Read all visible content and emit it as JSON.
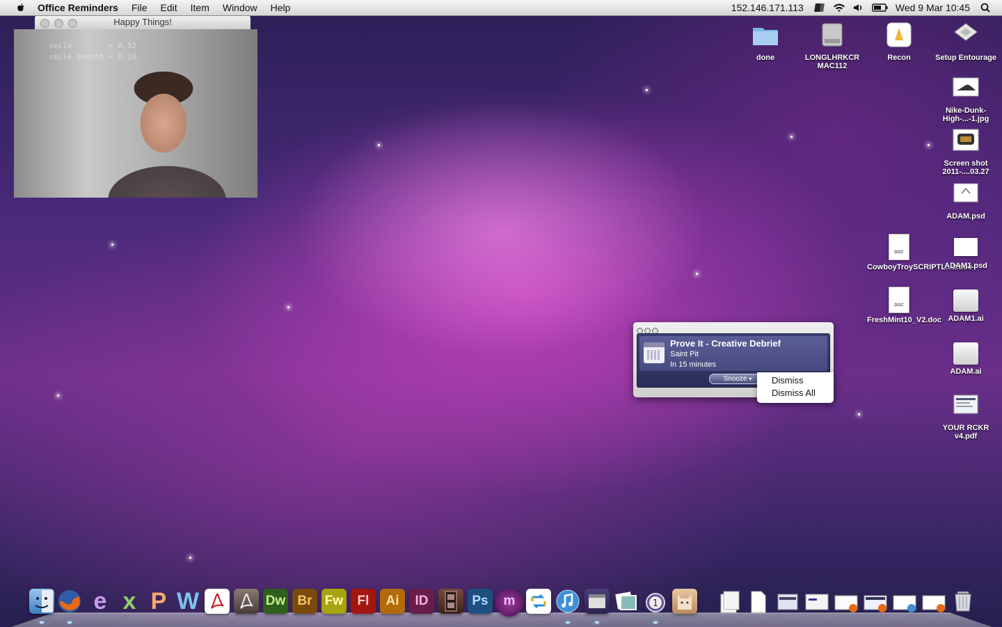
{
  "menubar": {
    "app_name": "Office Reminders",
    "items": [
      "File",
      "Edit",
      "Item",
      "Window",
      "Help"
    ],
    "ip_address": "152.146.171.113",
    "clock": "Wed 9 Mar  10:45",
    "status_icons": [
      "script-icon",
      "wifi-icon",
      "volume-icon",
      "battery-icon",
      "spotlight-icon"
    ]
  },
  "cam_window": {
    "title": "Happy Things!",
    "overlay_line1": "smile        = 0.52",
    "overlay_line2": "smile smooth = 0.10"
  },
  "desktop_icons": [
    {
      "label": "done",
      "icon": "folder-icon"
    },
    {
      "label": "LONGLHRKCR MAC112",
      "icon": "hard-drive-icon"
    },
    {
      "label": "Recon",
      "icon": "application-icon"
    },
    {
      "label": "Setup Entourage",
      "icon": "installer-icon"
    },
    {
      "label": "Nike-Dunk-High-...-1.jpg",
      "icon": "image-file-icon"
    },
    {
      "label": "Screen shot 2011-....03.27",
      "icon": "image-file-icon"
    },
    {
      "label": "ADAM.psd",
      "icon": "psd-file-icon"
    },
    {
      "label": "CowboyTroySCRIPTL...2.doc",
      "icon": "doc-file-icon"
    },
    {
      "label": "ADAM1.psd",
      "icon": "psd-file-icon"
    },
    {
      "label": "FreshMint10_V2.doc",
      "icon": "doc-file-icon"
    },
    {
      "label": "ADAM1.ai",
      "icon": "ai-file-icon"
    },
    {
      "label": "ADAM.ai",
      "icon": "ai-file-icon"
    },
    {
      "label": "YOUR RCKR v4.pdf",
      "icon": "pdf-file-icon"
    }
  ],
  "reminder": {
    "title": "Prove It - Creative Debrief",
    "location": "Saint Pit",
    "time": "In 15 minutes",
    "snooze_label": "Snooze",
    "menu": [
      "Dismiss",
      "Dismiss All"
    ]
  },
  "doc_badge": "DOC",
  "dock": {
    "apps": [
      "Finder",
      "Firefox",
      "e",
      "x",
      "P",
      "W",
      "Acrobat",
      "Acrobat Pro",
      "Dw",
      "Br",
      "Fw",
      "Fl",
      "Ai",
      "ID",
      "Film",
      "Ps",
      "m",
      "Recycle",
      "iTunes",
      "Calendar",
      "Photos",
      "Alarm",
      "Cat"
    ],
    "labels": {
      "dw": "Dw",
      "br": "Br",
      "fw": "Fw",
      "fl": "Fl",
      "ai": "Ai",
      "id": "ID",
      "ps": "Ps",
      "m": "m"
    }
  },
  "colors": {
    "dw": "#2e5f1f",
    "br": "#7a4a0c",
    "fw": "#a8a310",
    "fl": "#a3150f",
    "ai": "#b36a0b",
    "id": "#6b1d4a",
    "ps": "#1d4f80",
    "m": "#6a1a6e"
  }
}
